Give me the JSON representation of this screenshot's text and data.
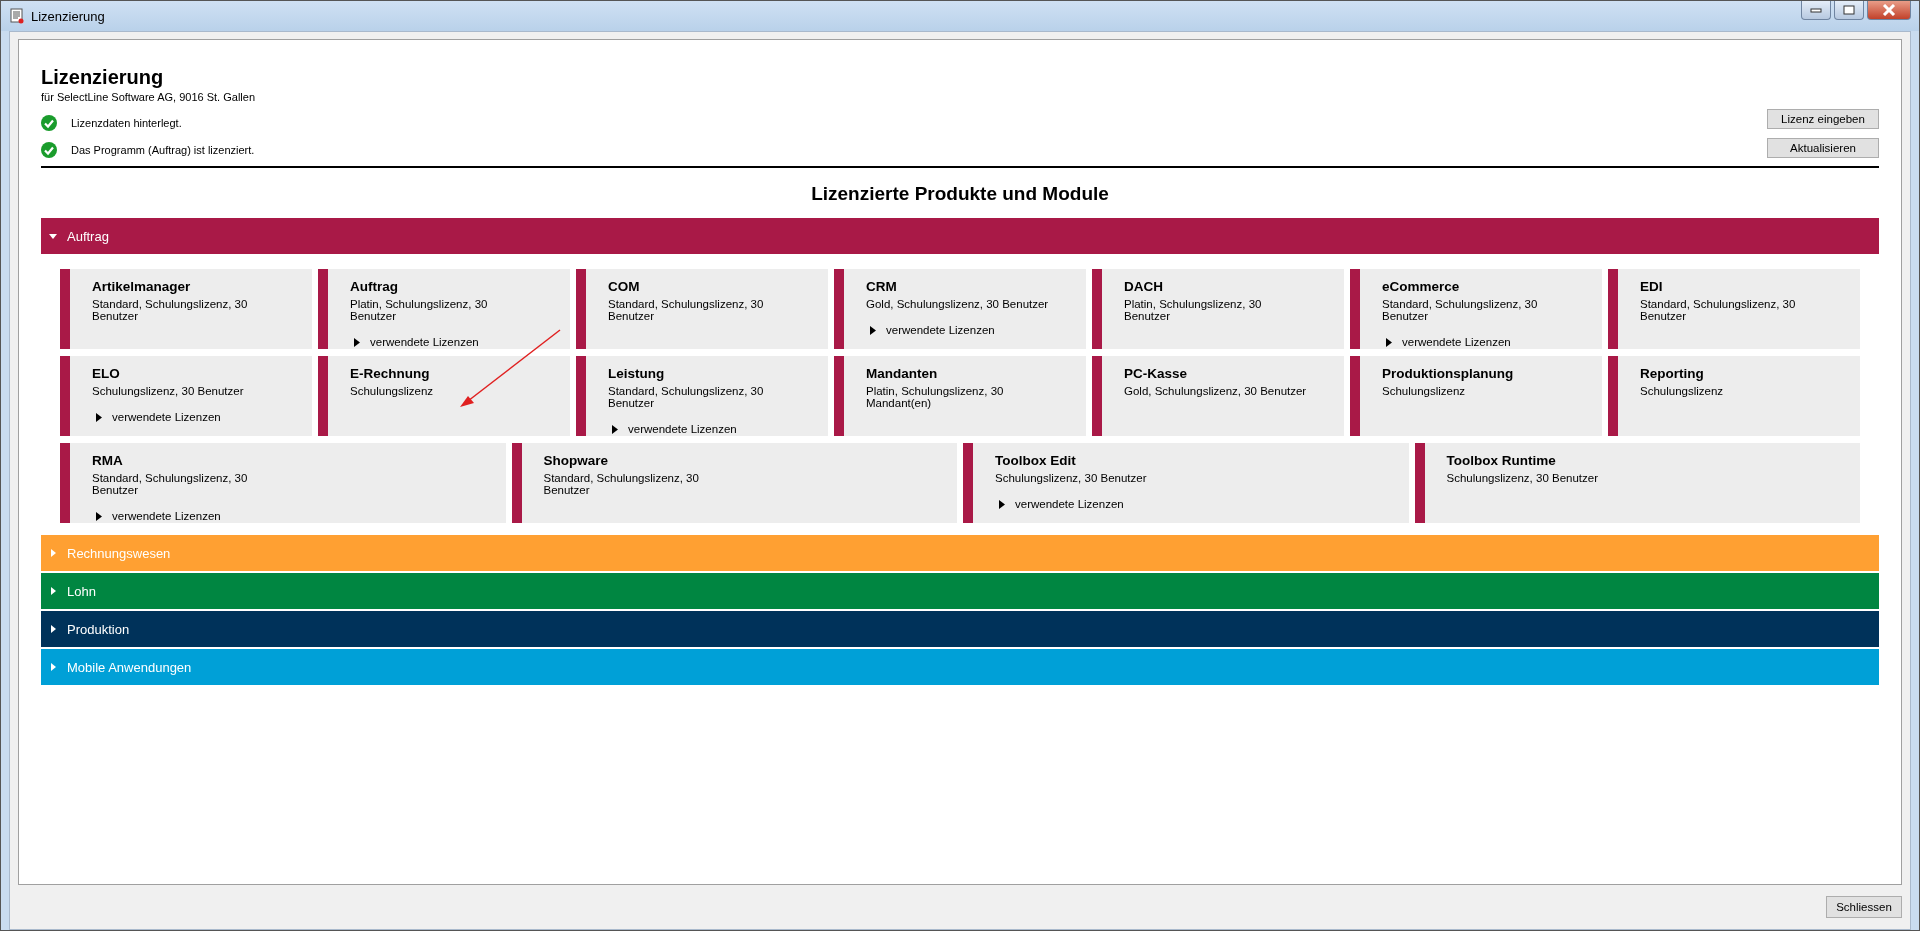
{
  "window": {
    "title": "Lizenzierung"
  },
  "header": {
    "title": "Lizenzierung",
    "subtitle": "für SelectLine Software AG, 9016 St. Gallen"
  },
  "status_messages": [
    {
      "text": "Lizenzdaten hinterlegt.",
      "ok": true
    },
    {
      "text": "Das Programm (Auftrag) ist lizenziert.",
      "ok": true
    }
  ],
  "header_buttons": [
    "Lizenz eingeben",
    "Aktualisieren"
  ],
  "section_title": "Lizenzierte Produkte und Module",
  "categories": [
    {
      "label": "Auftrag",
      "color": "#a91947",
      "expanded": true,
      "rows": [
        [
          {
            "name": "Artikelmanager",
            "detail": "Standard, Schulungslizenz, 30 Benutzer"
          },
          {
            "name": "Auftrag",
            "detail": "Platin, Schulungslizenz, 30 Benutzer",
            "link": "verwendete Lizenzen"
          },
          {
            "name": "COM",
            "detail": "Standard, Schulungslizenz, 30 Benutzer"
          },
          {
            "name": "CRM",
            "detail": "Gold, Schulungslizenz, 30 Benutzer",
            "link": "verwendete Lizenzen"
          },
          {
            "name": "DACH",
            "detail": "Platin, Schulungslizenz, 30 Benutzer"
          },
          {
            "name": "eCommerce",
            "detail": "Standard, Schulungslizenz, 30 Benutzer",
            "link": "verwendete Lizenzen"
          },
          {
            "name": "EDI",
            "detail": "Standard, Schulungslizenz, 30 Benutzer"
          }
        ],
        [
          {
            "name": "ELO",
            "detail": "Schulungslizenz, 30 Benutzer",
            "link": "verwendete Lizenzen"
          },
          {
            "name": "E-Rechnung",
            "detail": "Schulungslizenz"
          },
          {
            "name": "Leistung",
            "detail": "Standard, Schulungslizenz, 30 Benutzer",
            "link": "verwendete Lizenzen"
          },
          {
            "name": "Mandanten",
            "detail": "Platin, Schulungslizenz, 30 Mandant(en)"
          },
          {
            "name": "PC-Kasse",
            "detail": "Gold, Schulungslizenz, 30 Benutzer"
          },
          {
            "name": "Produktionsplanung",
            "detail": "Schulungslizenz"
          },
          {
            "name": "Reporting",
            "detail": "Schulungslizenz"
          }
        ],
        [
          {
            "name": "RMA",
            "detail": "Standard, Schulungslizenz, 30 Benutzer",
            "link": "verwendete Lizenzen"
          },
          {
            "name": "Shopware",
            "detail": "Standard, Schulungslizenz, 30 Benutzer"
          },
          {
            "name": "Toolbox Edit",
            "detail": "Schulungslizenz, 30 Benutzer",
            "link": "verwendete Lizenzen"
          },
          {
            "name": "Toolbox Runtime",
            "detail": "Schulungslizenz, 30 Benutzer"
          }
        ]
      ]
    },
    {
      "label": "Rechnungswesen",
      "color": "#ffa032",
      "expanded": false
    },
    {
      "label": "Lohn",
      "color": "#008641",
      "expanded": false
    },
    {
      "label": "Produktion",
      "color": "#00325a",
      "expanded": false
    },
    {
      "label": "Mobile Anwendungen",
      "color": "#00a0d7",
      "expanded": false
    }
  ],
  "footer_button": "Schliessen"
}
